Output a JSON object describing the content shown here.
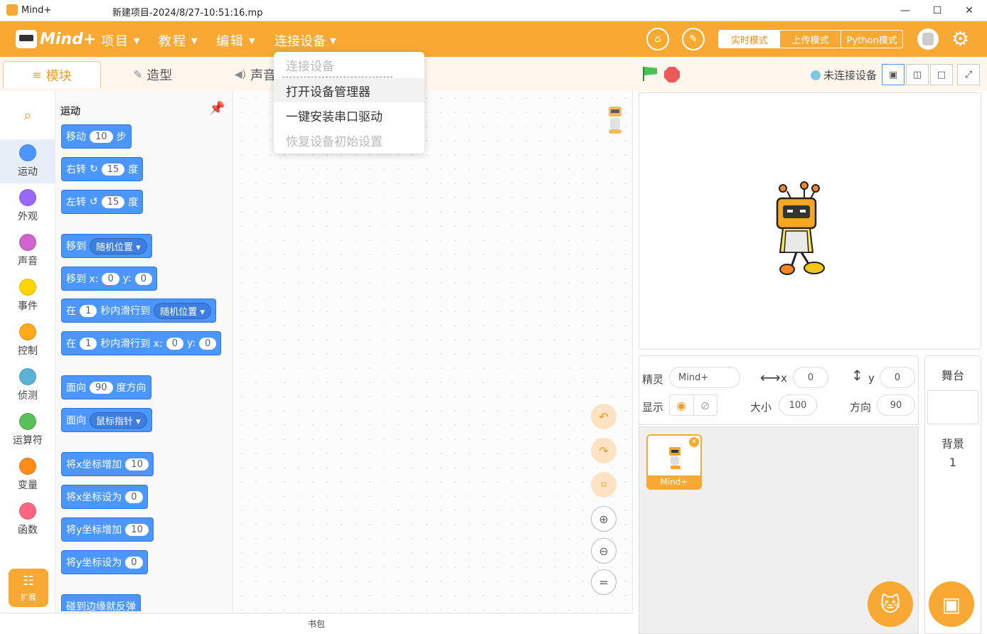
{
  "window": {
    "app_name": "Mind+",
    "doc_name": "新建项目-2024/8/27-10:51:16.mp",
    "min_glyph": "—",
    "max_glyph": "☐",
    "close_glyph": "✕"
  },
  "menubar": {
    "logo_text": "Mind+",
    "items": [
      {
        "label": "项目"
      },
      {
        "label": "教程"
      },
      {
        "label": "编辑"
      },
      {
        "label": "连接设备"
      }
    ],
    "modes": [
      "实时模式",
      "上传模式",
      "Python模式"
    ],
    "active_mode": "实时模式"
  },
  "dropdown": {
    "header": "连接设备",
    "items": [
      {
        "label": "打开设备管理器",
        "state": "hover"
      },
      {
        "label": "一键安装串口驱动",
        "state": "enabled"
      },
      {
        "label": "恢复设备初始设置",
        "state": "disabled"
      }
    ]
  },
  "tabs": [
    {
      "label": "模块",
      "icon": "blocks-icon",
      "active": true
    },
    {
      "label": "造型",
      "icon": "brush-icon",
      "active": false
    },
    {
      "label": "声音",
      "icon": "speaker-icon",
      "active": false
    }
  ],
  "categories": [
    {
      "label": "运动",
      "color": "#4c97ff"
    },
    {
      "label": "外观",
      "color": "#9966ff"
    },
    {
      "label": "声音",
      "color": "#cf63cf"
    },
    {
      "label": "事件",
      "color": "#ffd500"
    },
    {
      "label": "控制",
      "color": "#ffab19"
    },
    {
      "label": "侦测",
      "color": "#5cb1d6"
    },
    {
      "label": "运算符",
      "color": "#59c059"
    },
    {
      "label": "变量",
      "color": "#ff8c1a"
    },
    {
      "label": "函数",
      "color": "#ff6680"
    }
  ],
  "extension_label": "扩展",
  "palette": {
    "section_title": "运动",
    "blocks": {
      "move": {
        "a": "移动",
        "n": "10",
        "b": "步"
      },
      "turn_right": {
        "a": "右转",
        "n": "15",
        "b": "度"
      },
      "turn_left": {
        "a": "左转",
        "n": "15",
        "b": "度"
      },
      "goto": {
        "a": "移到",
        "drop": "随机位置"
      },
      "goto_xy": {
        "a": "移到 x:",
        "x": "0",
        "b": "y:",
        "y": "0"
      },
      "glide_to": {
        "a": "在",
        "n": "1",
        "b": "秒内滑行到",
        "drop": "随机位置"
      },
      "glide_xy": {
        "a": "在",
        "n": "1",
        "b": "秒内滑行到 x:",
        "x": "0",
        "c": "y:",
        "y": "0"
      },
      "point_dir": {
        "a": "面向",
        "n": "90",
        "b": "度方向"
      },
      "point_towards": {
        "a": "面向",
        "drop": "鼠标指针"
      },
      "change_x": {
        "a": "将x坐标增加",
        "n": "10"
      },
      "set_x": {
        "a": "将x坐标设为",
        "n": "0"
      },
      "change_y": {
        "a": "将y坐标增加",
        "n": "10"
      },
      "set_y": {
        "a": "将y坐标设为",
        "n": "0"
      },
      "bounce": {
        "a": "碰到边缘就反弹"
      }
    }
  },
  "backpack_label": "书包",
  "stage_header": {
    "status": "未连接设备"
  },
  "sprite_info": {
    "sprite_label": "精灵",
    "sprite_name": "Mind+",
    "x_label": "x",
    "x_value": "0",
    "y_label": "y",
    "y_value": "0",
    "show_label": "显示",
    "size_label": "大小",
    "size_value": "100",
    "direction_label": "方向",
    "direction_value": "90"
  },
  "sprites": [
    {
      "name": "Mind+"
    }
  ],
  "stage_panel": {
    "title": "舞台",
    "backdrop_label": "背景",
    "backdrop_count": "1"
  },
  "colors": {
    "brand_orange": "#f7a934",
    "motion_blue": "#4c97ff",
    "flag_green": "#4cbf56",
    "stop_red": "#ec5959"
  }
}
